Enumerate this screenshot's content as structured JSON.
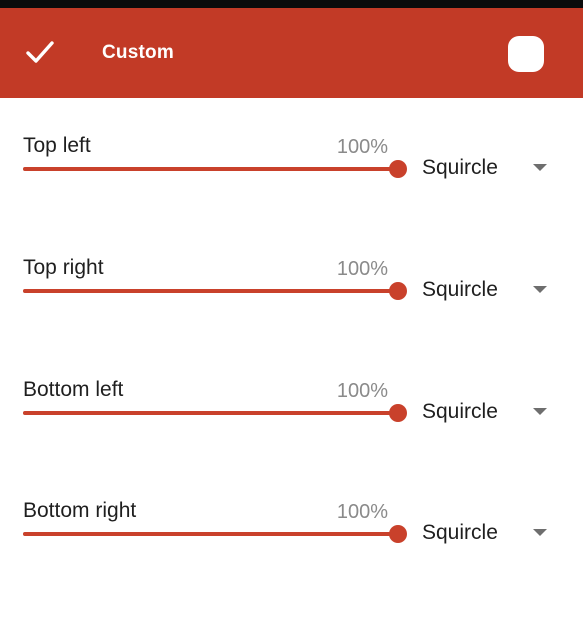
{
  "app_bar": {
    "title": "Custom",
    "confirm_icon": "check-icon",
    "preview_icon": "squircle-preview-icon",
    "background_color": "#c23a26"
  },
  "corners": [
    {
      "label": "Top left",
      "value_text": "100%",
      "value": 100,
      "shape": "Squircle"
    },
    {
      "label": "Top right",
      "value_text": "100%",
      "value": 100,
      "shape": "Squircle"
    },
    {
      "label": "Bottom left",
      "value_text": "100%",
      "value": 100,
      "shape": "Squircle"
    },
    {
      "label": "Bottom right",
      "value_text": "100%",
      "value": 100,
      "shape": "Squircle"
    }
  ],
  "accent_color": "#c9412b"
}
